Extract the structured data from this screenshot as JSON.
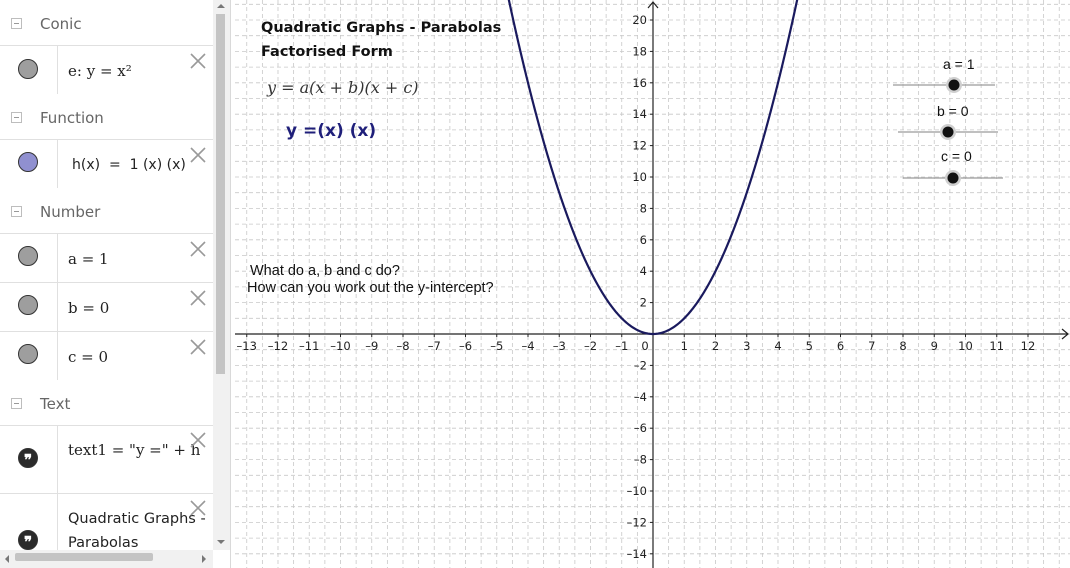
{
  "algebra_view": {
    "categories": [
      {
        "label": "Conic"
      },
      {
        "label": "Function"
      },
      {
        "label": "Number"
      },
      {
        "label": "Text"
      }
    ],
    "items": [
      {
        "text": "e: y = x²",
        "icon": "marble-icon",
        "color": "#9e9e9e"
      },
      {
        "text": "h(x)  =  1 (x) (x)",
        "icon": "marble-icon",
        "color": "#9090d0"
      },
      {
        "text": "a = 1",
        "icon": "marble-icon",
        "color": "#9e9e9e"
      },
      {
        "text": "b = 0",
        "icon": "marble-icon",
        "color": "#9e9e9e"
      },
      {
        "text": "c = 0",
        "icon": "marble-icon",
        "color": "#9e9e9e"
      },
      {
        "text": "text1 = \"y =\" + h",
        "icon": "quote-icon"
      },
      {
        "text": "Quadratic Graphs - Parabolas",
        "icon": "quote-icon"
      }
    ],
    "quote_glyph": "❞"
  },
  "graphics": {
    "title_line1": "Quadratic Graphs - Parabolas",
    "title_line2": "Factorised Form",
    "formula": "y = a(x + b)(x + c)",
    "equation_text": "y =(x) (x)",
    "equation_color": "#1f1f7a",
    "question1": "What do a, b and c do?",
    "question2": "How can you work out the y-intercept?",
    "curve_color": "#1a1a5e",
    "sliders": [
      {
        "label": "a = 1",
        "value": 1
      },
      {
        "label": "b = 0",
        "value": 0
      },
      {
        "label": "c = 0",
        "value": 0
      }
    ],
    "x_ticks": [
      "–13",
      "–12",
      "–11",
      "–10",
      "–9",
      "–8",
      "–7",
      "–6",
      "–5",
      "–4",
      "–3",
      "–2",
      "–1",
      "0",
      "1",
      "2",
      "3",
      "4",
      "5",
      "6",
      "7",
      "8",
      "9",
      "10",
      "11",
      "12"
    ],
    "y_ticks_pos": [
      "2",
      "4",
      "6",
      "8",
      "10",
      "12",
      "14",
      "16",
      "18",
      "20"
    ],
    "y_ticks_neg": [
      "–2",
      "–4",
      "–6",
      "–8",
      "–10",
      "–12",
      "–14"
    ]
  }
}
